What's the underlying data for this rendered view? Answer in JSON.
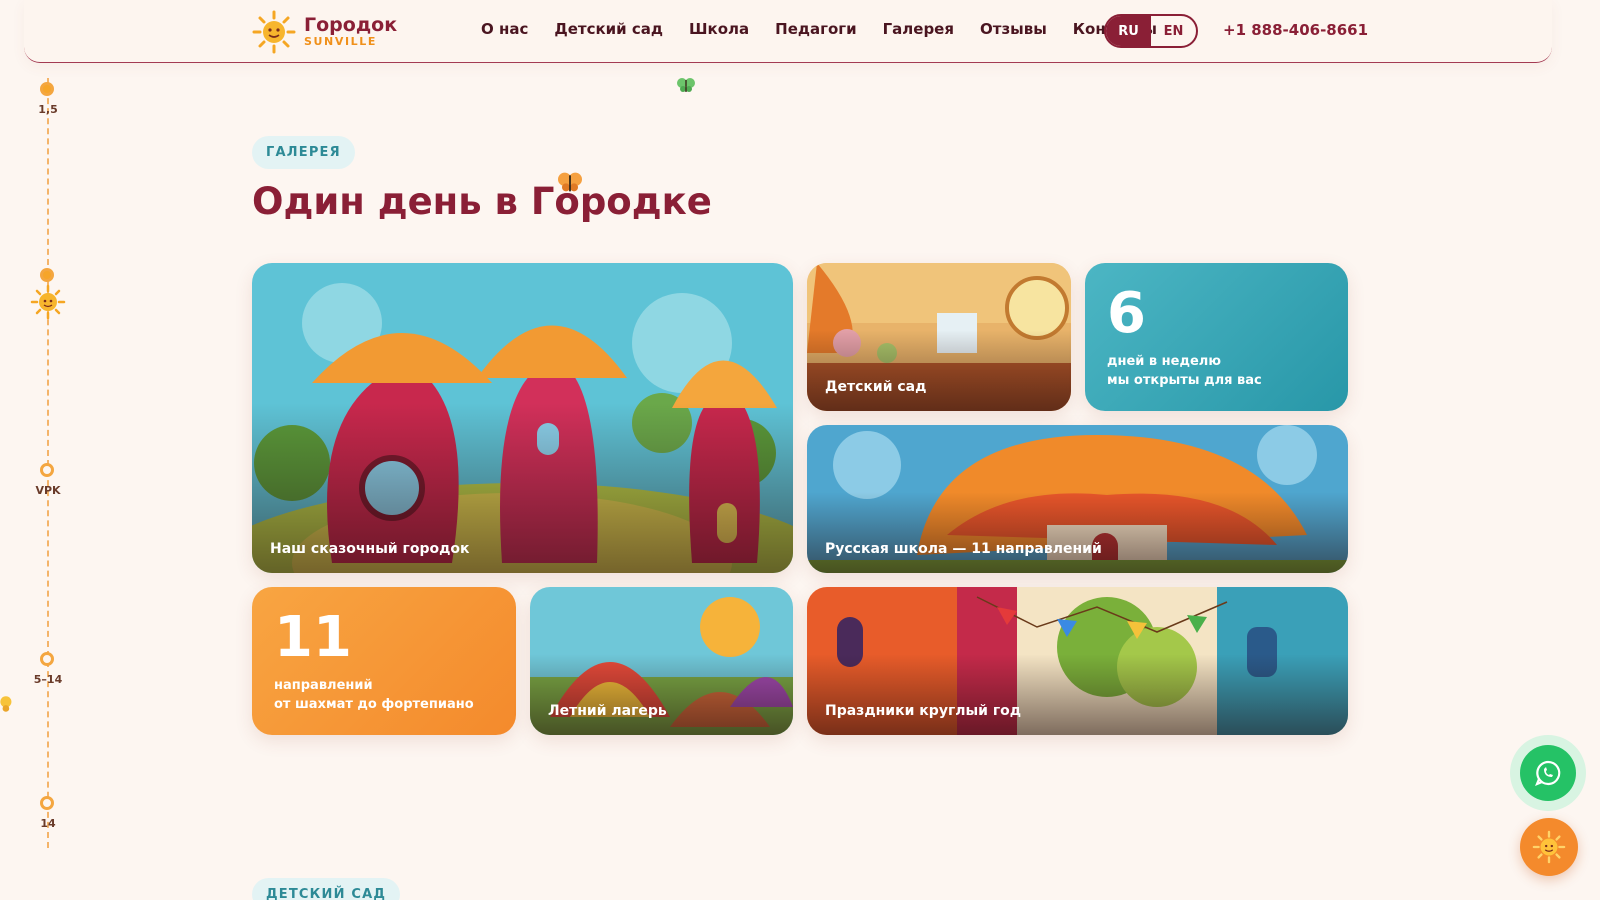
{
  "header": {
    "logo_name": "Городок",
    "logo_sub": "SUNVILLE",
    "nav": [
      "О нас",
      "Детский сад",
      "Школа",
      "Педагоги",
      "Галерея",
      "Отзывы",
      "Контакты"
    ],
    "lang_active": "RU",
    "lang_other": "EN",
    "phone": "+1 888-406-8661"
  },
  "timeline": {
    "labels": [
      "1,5",
      "VPK",
      "5–14",
      "14"
    ]
  },
  "gallery": {
    "pill": "ГАЛЕРЕЯ",
    "title": "Один день в Городке",
    "tiles": {
      "town": "Наш сказочный городок",
      "kindergarten": "Детский сад",
      "school": "Русская школа — 11 направлений",
      "camp": "Летний лагерь",
      "holidays": "Праздники круглый год"
    },
    "stat_days": {
      "number": "6",
      "line1": "дней в неделю",
      "line2": "мы открыты для вас"
    },
    "stat_dirs": {
      "number": "11",
      "line1": "направлений",
      "line2": "от шахмат до фортепиано"
    }
  },
  "next_section": {
    "pill": "ДЕТСКИЙ САД"
  },
  "colors": {
    "brand": "#8a1f36",
    "accent_orange": "#f6a52a",
    "teal": "#2fa6b4",
    "whatsapp": "#25c266"
  },
  "icons": [
    "sun-logo-icon",
    "butterfly-icon",
    "whatsapp-icon",
    "sun-mascot-icon"
  ]
}
